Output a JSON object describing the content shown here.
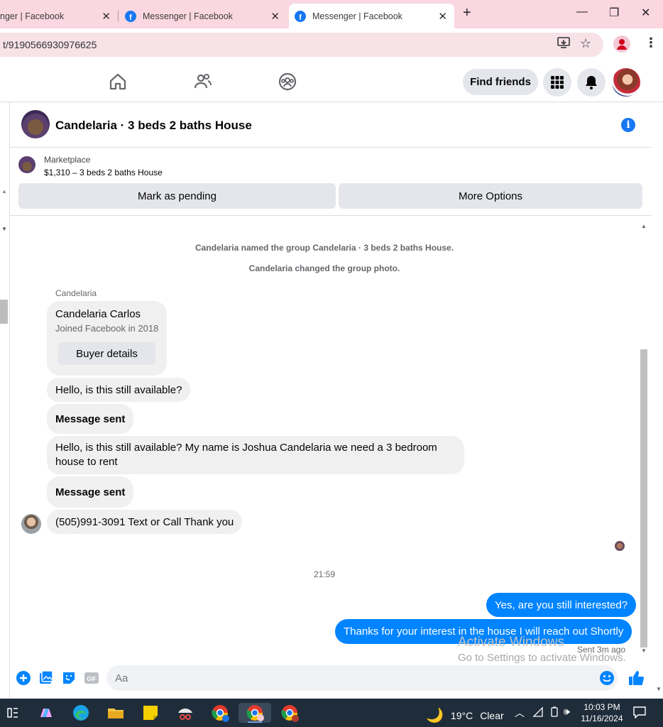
{
  "browser": {
    "tabs": [
      {
        "title": "nger | Facebook"
      },
      {
        "title": "Messenger | Facebook"
      },
      {
        "title": "Messenger | Facebook"
      }
    ],
    "url": "t/9190566930976625"
  },
  "fbnav": {
    "find_friends": "Find friends"
  },
  "conversation": {
    "title": "Candelaria · 3 beds 2 baths House",
    "marketplace_label": "Marketplace",
    "listing": "$1,310 – 3 beds 2 baths House",
    "mark_pending": "Mark as pending",
    "more_options": "More Options"
  },
  "messages": {
    "system1": "Candelaria named the group Candelaria · 3 beds 2 baths House.",
    "system2": "Candelaria changed the group photo.",
    "sender_name": "Candelaria",
    "card_name": "Candelaria Carlos",
    "card_sub": "Joined Facebook in 2018",
    "buyer_details": "Buyer details",
    "in1": "Hello, is this still available?",
    "in2": "Message sent",
    "in3": "Hello, is this still available? My name is Joshua Candelaria we need a 3 bedroom house to rent",
    "in4": "Message sent",
    "in5": "(505)991-3091 Text or Call Thank you",
    "timestamp": "21:59",
    "out1": "Yes, are you still interested?",
    "out2": "Thanks for your interest in the house I will reach out Shortly",
    "sent_status": "Sent 3m ago"
  },
  "composer": {
    "placeholder": "Aa"
  },
  "watermark": {
    "line1": "Activate Windows",
    "line2": "Go to Settings to activate Windows."
  },
  "taskbar": {
    "temp": "19°C",
    "condition": "Clear",
    "time": "10:03 PM",
    "date": "11/16/2024"
  },
  "colors": {
    "messenger_blue": "#0084ff",
    "fb_blue": "#1877f2",
    "bubble_grey": "#f0f0f0",
    "tab_pink": "#fad7e1"
  }
}
